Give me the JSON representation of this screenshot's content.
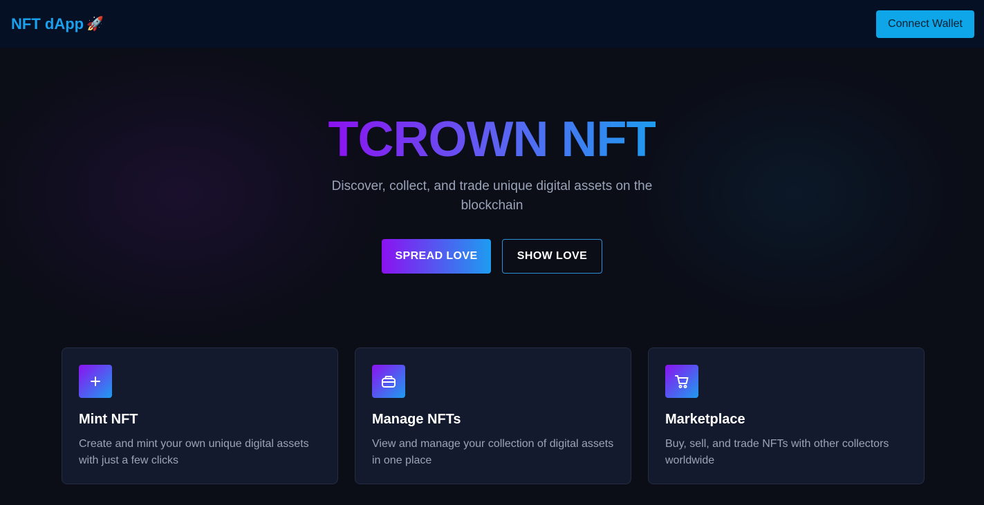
{
  "navbar": {
    "brand": "NFT dApp",
    "brand_icon": "rocket-icon",
    "connect_label": "Connect Wallet"
  },
  "hero": {
    "title": "TCROWN NFT",
    "subtitle": "Discover, collect, and trade unique digital assets on the blockchain",
    "primary_label": "SPREAD LOVE",
    "secondary_label": "SHOW LOVE"
  },
  "features": [
    {
      "icon": "plus-icon",
      "title": "Mint NFT",
      "description": "Create and mint your own unique digital assets with just a few clicks"
    },
    {
      "icon": "wallet-icon",
      "title": "Manage NFTs",
      "description": "View and manage your collection of digital assets in one place"
    },
    {
      "icon": "cart-icon",
      "title": "Marketplace",
      "description": "Buy, sell, and trade NFTs with other collectors worldwide"
    }
  ],
  "colors": {
    "accent_purple": "#8b12f0",
    "accent_blue": "#1e9cf0",
    "brand_blue": "#1aa0ec",
    "connect_button": "#0ea5e9"
  }
}
